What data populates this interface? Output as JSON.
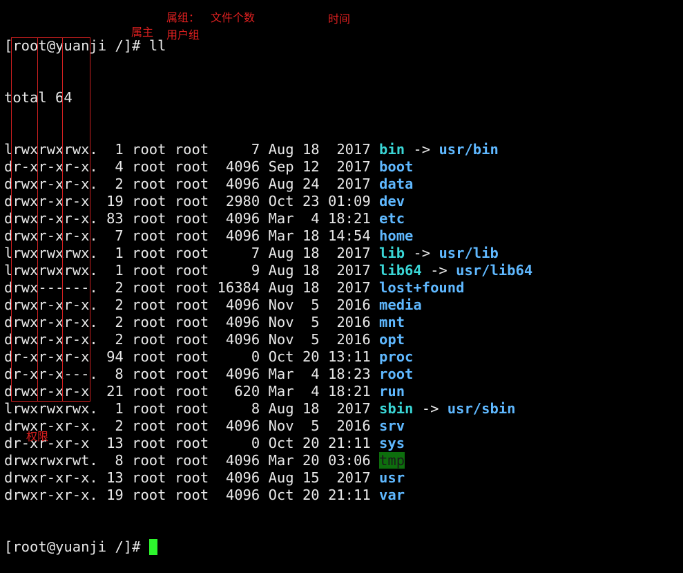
{
  "terminal": {
    "prompt": "[root@yuanji /]# ",
    "command": "ll",
    "total_line": "total 64",
    "entries": [
      {
        "perm": "lrwxrwxrwx.",
        "links": "1",
        "owner": "root",
        "group": "root",
        "size": "7",
        "month": "Aug",
        "day": "18",
        "time": "2017",
        "name": "bin",
        "kind": "link",
        "target": "usr/bin"
      },
      {
        "perm": "dr-xr-xr-x.",
        "links": "4",
        "owner": "root",
        "group": "root",
        "size": "4096",
        "month": "Sep",
        "day": "12",
        "time": "2017",
        "name": "boot",
        "kind": "dir"
      },
      {
        "perm": "drwxr-xr-x.",
        "links": "2",
        "owner": "root",
        "group": "root",
        "size": "4096",
        "month": "Aug",
        "day": "24",
        "time": "2017",
        "name": "data",
        "kind": "dir"
      },
      {
        "perm": "drwxr-xr-x",
        "links": "19",
        "owner": "root",
        "group": "root",
        "size": "2980",
        "month": "Oct",
        "day": "23",
        "time": "01:09",
        "name": "dev",
        "kind": "dir"
      },
      {
        "perm": "drwxr-xr-x.",
        "links": "83",
        "owner": "root",
        "group": "root",
        "size": "4096",
        "month": "Mar",
        "day": "4",
        "time": "18:21",
        "name": "etc",
        "kind": "dir"
      },
      {
        "perm": "drwxr-xr-x.",
        "links": "7",
        "owner": "root",
        "group": "root",
        "size": "4096",
        "month": "Mar",
        "day": "18",
        "time": "14:54",
        "name": "home",
        "kind": "dir"
      },
      {
        "perm": "lrwxrwxrwx.",
        "links": "1",
        "owner": "root",
        "group": "root",
        "size": "7",
        "month": "Aug",
        "day": "18",
        "time": "2017",
        "name": "lib",
        "kind": "link",
        "target": "usr/lib"
      },
      {
        "perm": "lrwxrwxrwx.",
        "links": "1",
        "owner": "root",
        "group": "root",
        "size": "9",
        "month": "Aug",
        "day": "18",
        "time": "2017",
        "name": "lib64",
        "kind": "link",
        "target": "usr/lib64"
      },
      {
        "perm": "drwx------.",
        "links": "2",
        "owner": "root",
        "group": "root",
        "size": "16384",
        "month": "Aug",
        "day": "18",
        "time": "2017",
        "name": "lost+found",
        "kind": "dir"
      },
      {
        "perm": "drwxr-xr-x.",
        "links": "2",
        "owner": "root",
        "group": "root",
        "size": "4096",
        "month": "Nov",
        "day": "5",
        "time": "2016",
        "name": "media",
        "kind": "dir"
      },
      {
        "perm": "drwxr-xr-x.",
        "links": "2",
        "owner": "root",
        "group": "root",
        "size": "4096",
        "month": "Nov",
        "day": "5",
        "time": "2016",
        "name": "mnt",
        "kind": "dir"
      },
      {
        "perm": "drwxr-xr-x.",
        "links": "2",
        "owner": "root",
        "group": "root",
        "size": "4096",
        "month": "Nov",
        "day": "5",
        "time": "2016",
        "name": "opt",
        "kind": "dir"
      },
      {
        "perm": "dr-xr-xr-x",
        "links": "94",
        "owner": "root",
        "group": "root",
        "size": "0",
        "month": "Oct",
        "day": "20",
        "time": "13:11",
        "name": "proc",
        "kind": "dir"
      },
      {
        "perm": "dr-xr-x---.",
        "links": "8",
        "owner": "root",
        "group": "root",
        "size": "4096",
        "month": "Mar",
        "day": "4",
        "time": "18:23",
        "name": "root",
        "kind": "dir"
      },
      {
        "perm": "drwxr-xr-x",
        "links": "21",
        "owner": "root",
        "group": "root",
        "size": "620",
        "month": "Mar",
        "day": "4",
        "time": "18:21",
        "name": "run",
        "kind": "dir"
      },
      {
        "perm": "lrwxrwxrwx.",
        "links": "1",
        "owner": "root",
        "group": "root",
        "size": "8",
        "month": "Aug",
        "day": "18",
        "time": "2017",
        "name": "sbin",
        "kind": "link",
        "target": "usr/sbin"
      },
      {
        "perm": "drwxr-xr-x.",
        "links": "2",
        "owner": "root",
        "group": "root",
        "size": "4096",
        "month": "Nov",
        "day": "5",
        "time": "2016",
        "name": "srv",
        "kind": "dir"
      },
      {
        "perm": "dr-xr-xr-x",
        "links": "13",
        "owner": "root",
        "group": "root",
        "size": "0",
        "month": "Oct",
        "day": "20",
        "time": "21:11",
        "name": "sys",
        "kind": "dir"
      },
      {
        "perm": "drwxrwxrwt.",
        "links": "8",
        "owner": "root",
        "group": "root",
        "size": "4096",
        "month": "Mar",
        "day": "20",
        "time": "03:06",
        "name": "tmp",
        "kind": "sticky"
      },
      {
        "perm": "drwxr-xr-x.",
        "links": "13",
        "owner": "root",
        "group": "root",
        "size": "4096",
        "month": "Aug",
        "day": "15",
        "time": "2017",
        "name": "usr",
        "kind": "dir"
      },
      {
        "perm": "drwxr-xr-x.",
        "links": "19",
        "owner": "root",
        "group": "root",
        "size": "4096",
        "month": "Oct",
        "day": "20",
        "time": "21:11",
        "name": "var",
        "kind": "dir"
      }
    ]
  },
  "annotations": {
    "group_label": "属组：",
    "file_count_label": "文件个数",
    "time_label": "时间",
    "owner_label": "属主",
    "user_group_label": "用户组",
    "permission_label": "权限"
  },
  "colors": {
    "background": "#000000",
    "text": "#e8e8e8",
    "directory": "#5fb8ff",
    "symlink": "#3ad6d6",
    "sticky_bg": "#0d6e0d",
    "cursor": "#2df52d",
    "annotation": "#e02020"
  }
}
